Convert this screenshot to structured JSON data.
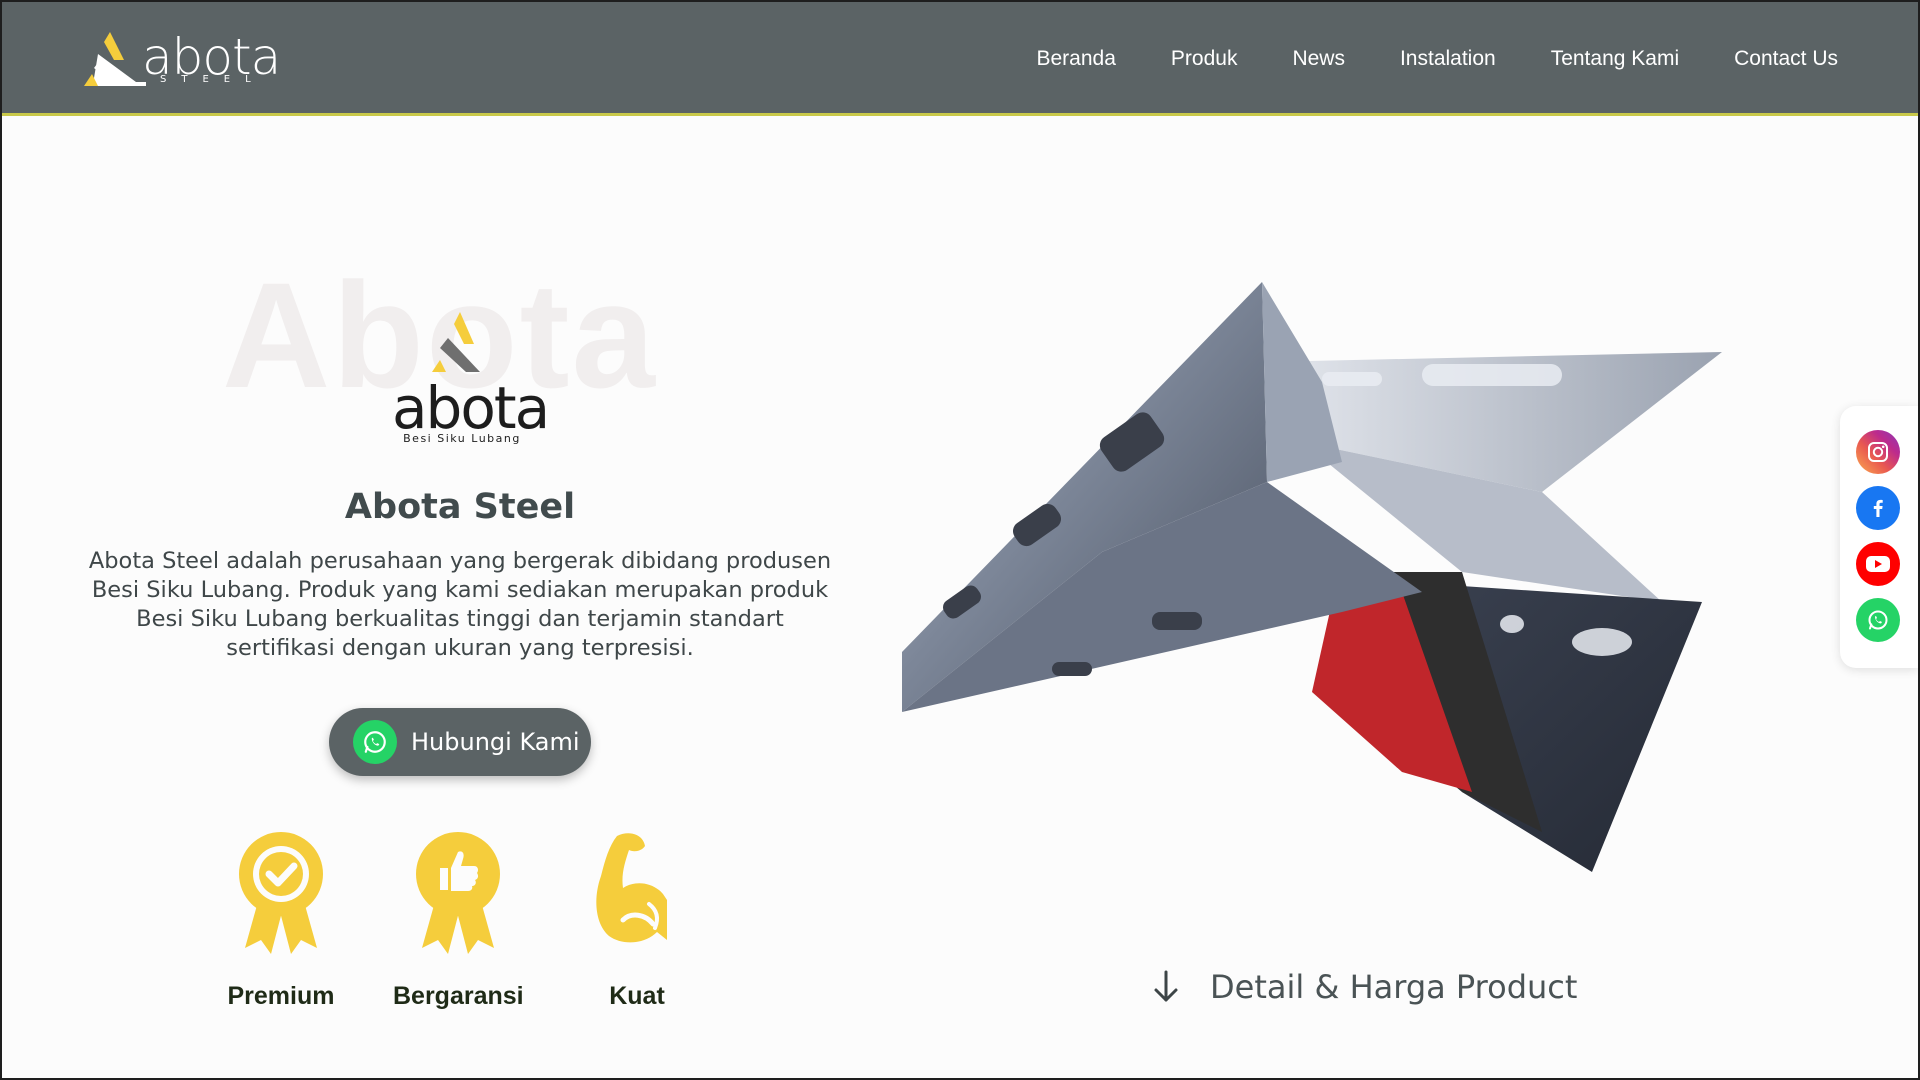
{
  "brand": {
    "name": "abota",
    "subtitle": "STEEL",
    "colors": {
      "nav_bg": "#5b6365",
      "accent_yellow": "#f5cd3c",
      "nav_underline": "#c9c94a"
    }
  },
  "nav": {
    "items": [
      {
        "label": "Beranda"
      },
      {
        "label": "Produk"
      },
      {
        "label": "News"
      },
      {
        "label": "Instalation"
      },
      {
        "label": "Tentang Kami"
      },
      {
        "label": "Contact Us"
      }
    ]
  },
  "hero": {
    "watermark": "Abota",
    "logo_word": "abota",
    "logo_tagline": "Besi Siku Lubang",
    "title_bold": "Abota",
    "title_rest": " Steel",
    "description_lines": [
      "Abota Steel adalah perusahaan yang bergerak dibidang produsen",
      "Besi Siku Lubang. Produk yang kami sediakan merupakan produk",
      "Besi Siku Lubang berkualitas tinggi dan terjamin standart",
      "sertifikasi dengan ukuran yang terpresisi."
    ],
    "cta_label": "Hubungi Kami",
    "cta_icon": "whatsapp-icon"
  },
  "features": [
    {
      "label": "Premium",
      "icon": "badge-check-icon"
    },
    {
      "label": "Bergaransi",
      "icon": "badge-thumbs-up-icon"
    },
    {
      "label": "Kuat",
      "icon": "flexed-arm-icon"
    }
  ],
  "product": {
    "image_alt": "perforated angle steel bars",
    "detail_link_label": "Detail & Harga Product",
    "detail_icon": "arrow-down-icon"
  },
  "social": [
    {
      "name": "instagram-icon",
      "color": "#d62976"
    },
    {
      "name": "facebook-icon",
      "color": "#1877f2"
    },
    {
      "name": "youtube-icon",
      "color": "#ff0000"
    },
    {
      "name": "whatsapp-icon",
      "color": "#25d366"
    }
  ]
}
